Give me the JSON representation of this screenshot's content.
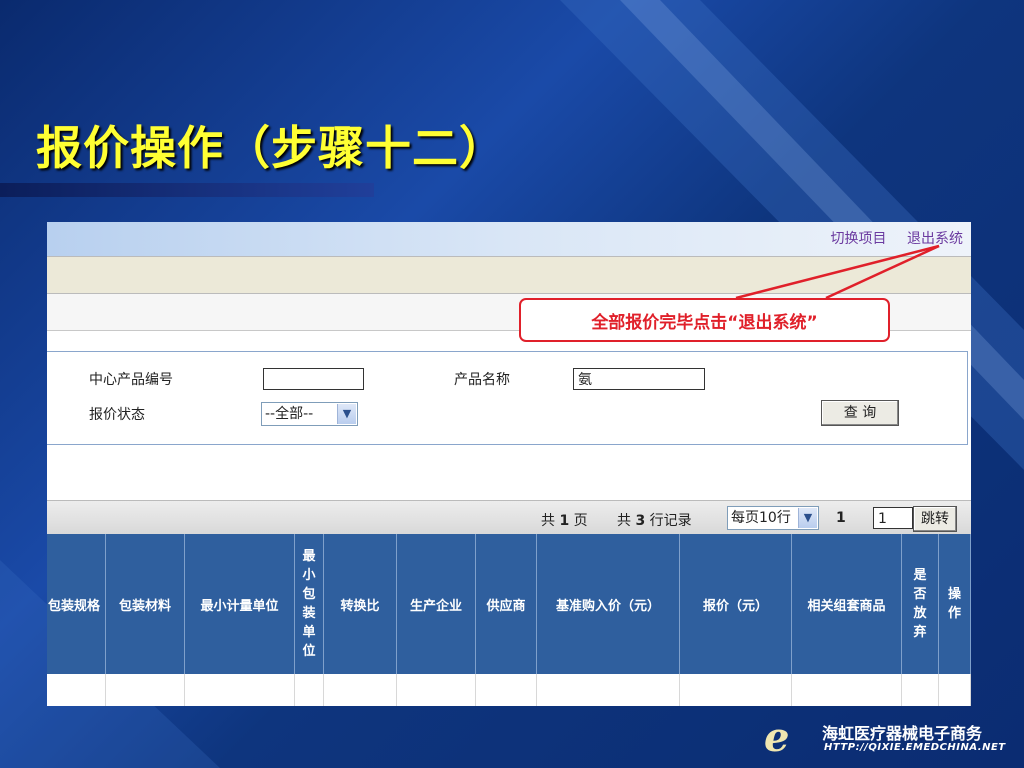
{
  "slide": {
    "title": "报价操作（步骤十二）"
  },
  "topnav": {
    "switch_project": "切换项目",
    "logout": "退出系统"
  },
  "callout": {
    "text": "全部报价完毕点击“退出系统”"
  },
  "search": {
    "center_code_label": "中心产品编号",
    "center_code_value": "",
    "product_name_label": "产品名称",
    "product_name_value": "氨",
    "quote_status_label": "报价状态",
    "quote_status_value": "--全部--",
    "query_button": "查 询"
  },
  "pager": {
    "total_prefix": "共",
    "total_pages": "1",
    "pages_suffix": "页",
    "records_prefix": "共",
    "total_records": "3",
    "records_suffix": "行记录",
    "per_page": "每页10行",
    "current_page": "1",
    "jump_value": "1",
    "jump_button": "跳转"
  },
  "table": {
    "headers": [
      "包装规格",
      "包装材料",
      "最小计量单位",
      "最小包装单位",
      "转换比",
      "生产企业",
      "供应商",
      "基准购入价（元）",
      "报价（元）",
      "相关组套商品",
      "是否放弃",
      "操作"
    ]
  },
  "logo": {
    "company": "海虹医疗器械电子商务",
    "url": "HTTP://QIXIE.EMEDCHINA.NET"
  }
}
